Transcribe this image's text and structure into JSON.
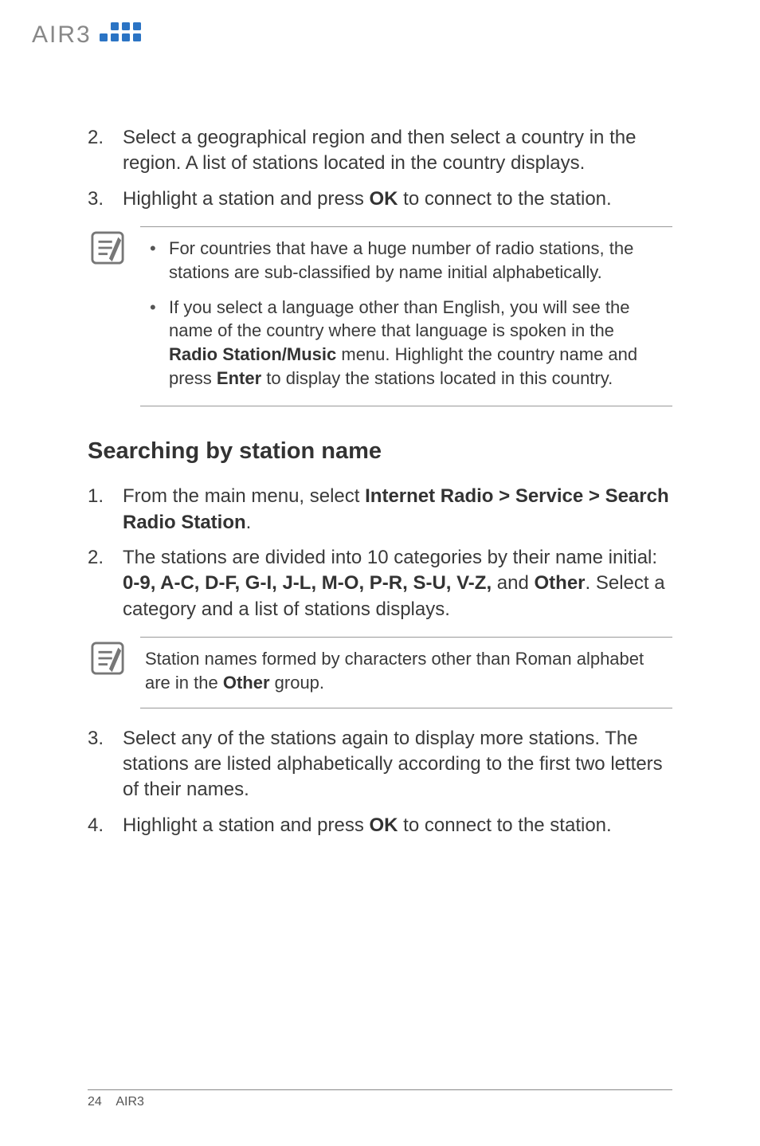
{
  "header": {
    "brand": "AIR3",
    "logo_alt": "air3-logo"
  },
  "content": {
    "top_steps": [
      {
        "n": "2.",
        "text": "Select a geographical region and then select a country in the region. A list of stations located in the country displays."
      },
      {
        "n": "3.",
        "text_before": "Highlight a station and press ",
        "bold1": "OK",
        "text_after": " to connect to the station."
      }
    ],
    "top_note": {
      "items": [
        {
          "text": "For countries that have a huge number of radio stations, the stations are sub-classified by name initial alphabetically."
        },
        {
          "text_before": "If you select a language other than English, you will see the name of the country where that language is spoken in the ",
          "bold1": "Radio Station/Music",
          "text_mid": " menu. Highlight the country name and press ",
          "bold2": "Enter",
          "text_after": " to display the stations located in this country."
        }
      ]
    },
    "section_title": "Searching by station name",
    "sec_steps": [
      {
        "n": "1.",
        "text_before": "From the main menu, select ",
        "bold1": "Internet Radio > Service > Search Radio Station",
        "text_after": "."
      },
      {
        "n": "2.",
        "text_before": "The stations are divided into 10 categories by their name initial: ",
        "bold1": "0-9, A-C, D-F, G-I, J-L, M-O, P-R, S-U, V-Z,",
        "text_mid": " and ",
        "bold2": "Other",
        "text_after": ". Select a category and a list of stations displays."
      }
    ],
    "sec_note": {
      "text_before": "Station names formed by characters other than Roman alphabet are in the ",
      "bold1": "Other",
      "text_after": " group."
    },
    "sec_steps_b": [
      {
        "n": "3.",
        "text": "Select any of the stations again to display more stations. The stations are listed alphabetically according to the first two letters of their names."
      },
      {
        "n": "4.",
        "text_before": "Highlight a station and press ",
        "bold1": "OK",
        "text_after": " to connect to the station."
      }
    ]
  },
  "footer": {
    "page_number": "24",
    "label": "AIR3"
  }
}
